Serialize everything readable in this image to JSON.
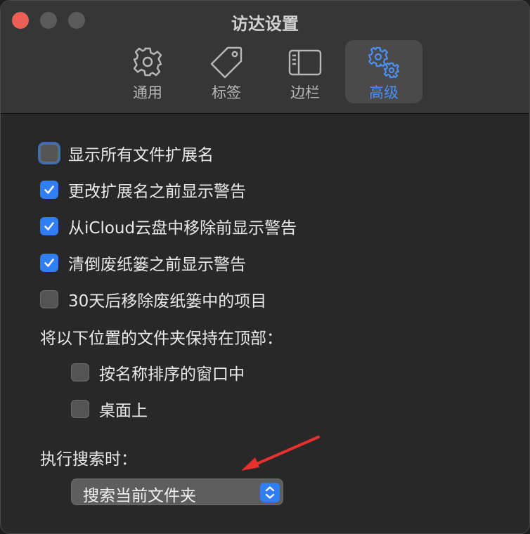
{
  "window": {
    "title": "访达设置"
  },
  "tabs": [
    {
      "label": "通用",
      "icon": "gear-icon",
      "active": false
    },
    {
      "label": "标签",
      "icon": "tag-icon",
      "active": false
    },
    {
      "label": "边栏",
      "icon": "sidebar-icon",
      "active": false
    },
    {
      "label": "高级",
      "icon": "gears-icon",
      "active": true
    }
  ],
  "options": [
    {
      "label": "显示所有文件扩展名",
      "checked": false
    },
    {
      "label": "更改扩展名之前显示警告",
      "checked": true
    },
    {
      "label": "从iCloud云盘中移除前显示警告",
      "checked": true
    },
    {
      "label": "清倒废纸篓之前显示警告",
      "checked": true
    },
    {
      "label": "30天后移除废纸篓中的项目",
      "checked": false
    }
  ],
  "keep_folders": {
    "heading": "将以下位置的文件夹保持在顶部：",
    "items": [
      {
        "label": "按名称排序的窗口中",
        "checked": false
      },
      {
        "label": "桌面上",
        "checked": false
      }
    ]
  },
  "search": {
    "heading": "执行搜索时：",
    "selected": "搜索当前文件夹"
  },
  "colors": {
    "accent": "#2f7ef5",
    "annotation_arrow": "#e8302f",
    "close_button": "#ec5f57"
  }
}
